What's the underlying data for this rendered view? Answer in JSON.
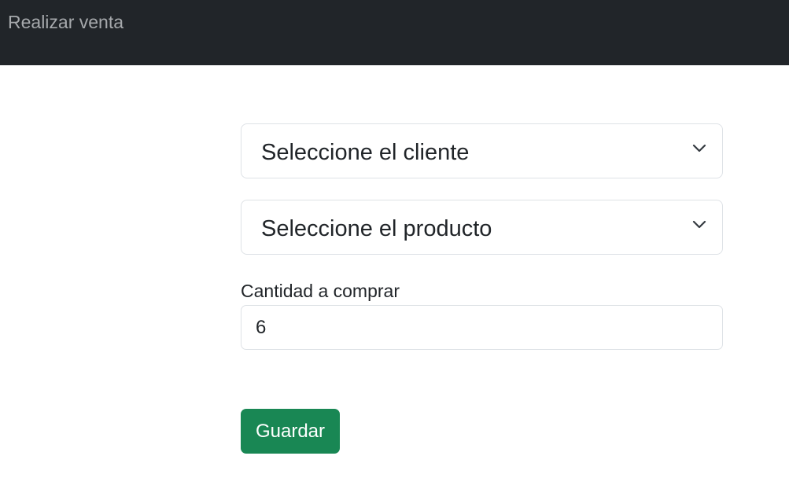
{
  "navbar": {
    "brand": "Realizar venta"
  },
  "form": {
    "client_select": {
      "selected": "Seleccione el cliente",
      "icon": "chevron-down-icon"
    },
    "product_select": {
      "selected": "Seleccione el producto",
      "icon": "chevron-down-icon"
    },
    "quantity": {
      "label": "Cantidad a comprar",
      "value": "6"
    },
    "save_button": {
      "label": "Guardar",
      "color": "#198754"
    }
  },
  "colors": {
    "navbar_bg": "#212529",
    "brand_text": "#a6a9ac",
    "border": "#dee2e6"
  }
}
